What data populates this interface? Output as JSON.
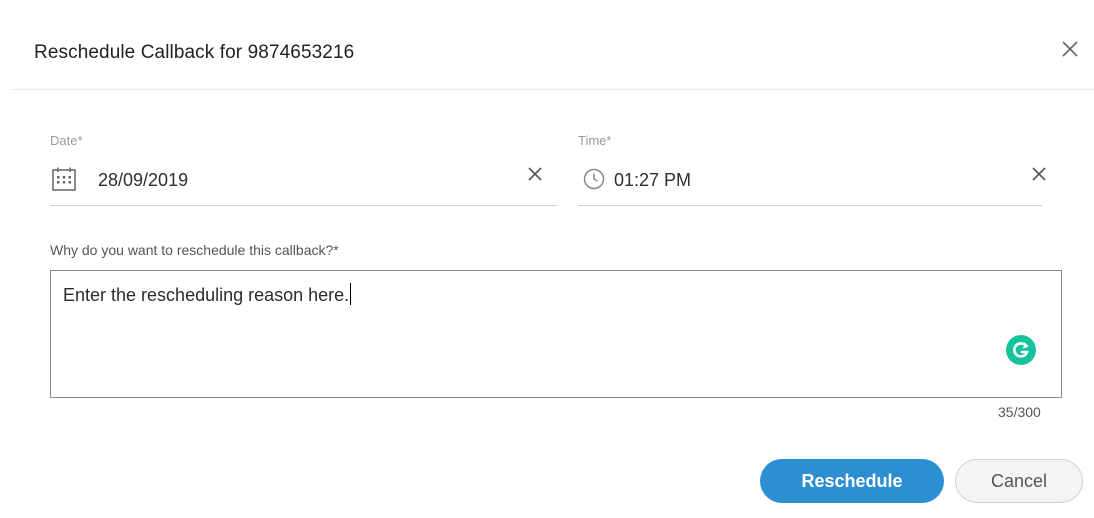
{
  "dialog": {
    "title": "Reschedule Callback for 9874653216",
    "close_icon": "close-icon"
  },
  "date": {
    "label": "Date*",
    "value": "28/09/2019",
    "icon": "calendar-icon"
  },
  "time": {
    "label": "Time*",
    "value": "01:27 PM",
    "icon": "clock-icon"
  },
  "reason": {
    "label": "Why do you want to reschedule this callback?*",
    "value": "Enter the rescheduling reason here.",
    "counter": "35/300",
    "assistant_icon": "grammarly-icon"
  },
  "actions": {
    "reschedule_label": "Reschedule",
    "cancel_label": "Cancel"
  },
  "colors": {
    "primary": "#2c8fd1",
    "grammarly": "#15c39a"
  }
}
